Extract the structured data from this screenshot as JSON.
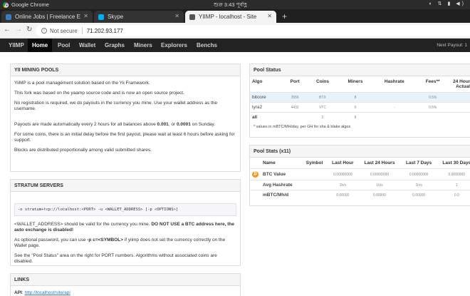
{
  "os": {
    "app": "Google Chrome",
    "clock": "শুক্র 3:43 পূর্বাহ্ণ"
  },
  "tabs": [
    {
      "title": "Online Jobs | Freelance E",
      "color": "#3b7bc4"
    },
    {
      "title": "Skype",
      "color": "#00aff0"
    },
    {
      "title": "YIIMP - localhost - Site",
      "color": "#555555"
    }
  ],
  "browser": {
    "not_secure": "Not secure",
    "url": "71.202.93.177"
  },
  "nav": {
    "items": [
      "YIIMP",
      "Home",
      "Pool",
      "Wallet",
      "Graphs",
      "Miners",
      "Explorers",
      "Benchs"
    ],
    "active": "Home",
    "payout": "Next Payout: 1"
  },
  "mining": {
    "title": "YII MINING POOLS",
    "p1": "YiiMP is a pool management solution based on the Yii Framework.",
    "p2": "This fork was based on the yaamp source code and is now an open source project.",
    "p3": "No registration is required, we do payouts in the currency you mine. Use your wallet address as the username.",
    "p4a": "Payouts are made automatically every 2 hours for all balances above ",
    "p4b": "0.001",
    "p4c": ", or ",
    "p4d": "0.0001",
    "p4e": " on Sunday.",
    "p5": "For some coins, there is an initial delay before the first payout, please wait at least 6 hours before asking for support.",
    "p6": "Blocks are distributed proportionally among valid submitted shares."
  },
  "stratum": {
    "title": "STRATUM SERVERS",
    "code": "-o stratum+tcp://localhost:<PORT> -u <WALLET_ADDRESS> [-p <OPTIONS>]",
    "p1a": "<WALLET_ADDRESS> should be valid for the currency you mine. ",
    "p1b": "DO NOT USE a BTC address here, the auto exchange is disabled!",
    "p2a": "As optional password, you can use ",
    "p2b": "-p c=<SYMBOL>",
    "p2c": " if yiimp does not set the currency correctly on the Wallet page.",
    "p3": "See the \"Pool Status\" area on the right for PORT numbers. Algorithms without associated coins are disabled."
  },
  "links": {
    "title": "LINKS",
    "api_label": "API",
    "api_url": "http://localhost/site/api"
  },
  "pool_status": {
    "title": "Pool Status",
    "headers": [
      "Algo",
      "Port",
      "Coins",
      "Miners",
      "Hashrate",
      "Fees**",
      "24 Hours Actual"
    ],
    "rows": [
      {
        "algo": "bitcore",
        "port": "3556",
        "coins": "BTX",
        "miners": "8",
        "hashrate": "",
        "fees": "0.5%"
      },
      {
        "algo": "lyra2",
        "port": "4432",
        "coins": "VTC",
        "miners": "0",
        "hashrate": "-",
        "fees": "0.5%"
      },
      {
        "algo": "all",
        "port": "",
        "coins": "2",
        "miners": "8",
        "hashrate": "",
        "fees": ""
      }
    ],
    "note": "* values in mBTC/MH/day, per GH for sha & blake algos"
  },
  "pool_stats": {
    "title": "Pool Stats (x11)",
    "headers": [
      "Name",
      "Symbol",
      "Last Hour",
      "Last 24 Hours",
      "Last 7 Days",
      "Last 30 Days"
    ],
    "rows": [
      {
        "name": "BTC Value",
        "symbol": "",
        "h1": "0.00000000",
        "h24": "0.00000000",
        "d7": "0.00000000",
        "d30": "0.0000000"
      },
      {
        "name": "Avg Hashrate",
        "symbol": "",
        "h1": "1h/s",
        "h24": "1h/s",
        "d7": "1h/s",
        "d30": "1"
      },
      {
        "name": "mBTC/Mh/d",
        "symbol": "",
        "h1": "0.00000",
        "h24": "0.00000",
        "d7": "0.00000",
        "d30": "0.0"
      }
    ]
  }
}
